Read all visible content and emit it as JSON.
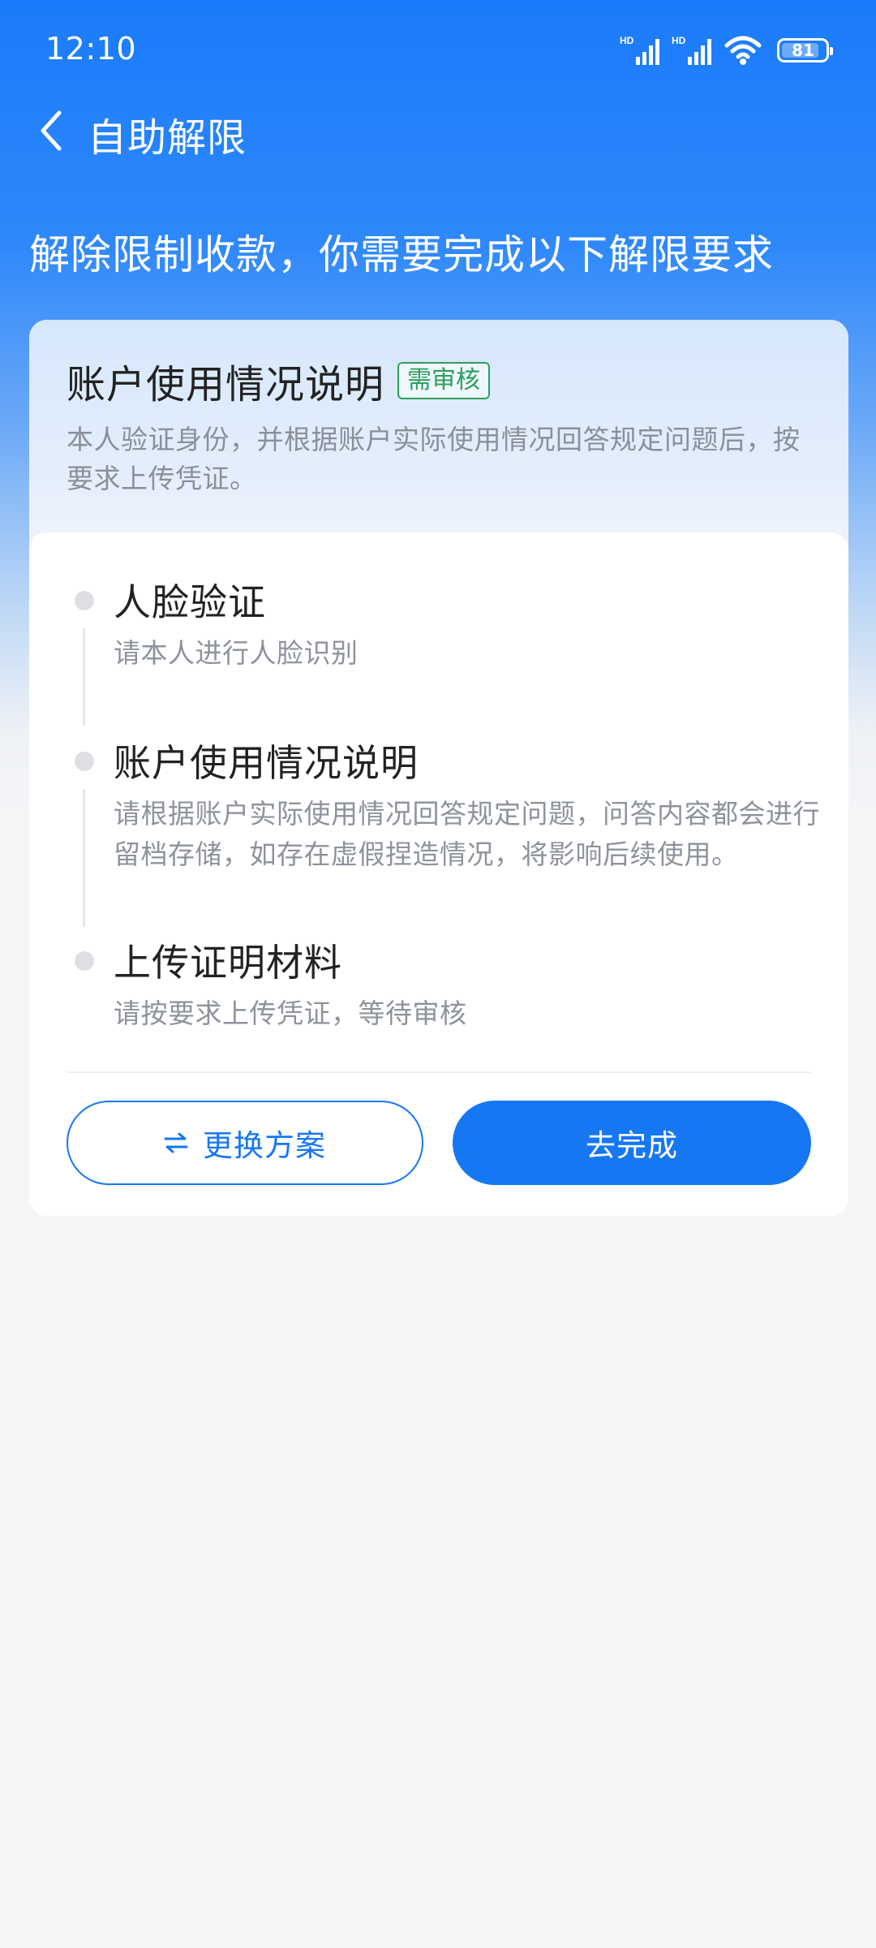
{
  "status_bar": {
    "time": "12:10",
    "battery_level": "81",
    "signal_1_label": "HD",
    "signal_2_label": "HD"
  },
  "nav": {
    "title": "自助解限",
    "back_icon": "chevron-left-icon"
  },
  "headline": "解除限制收款，你需要完成以下解限要求",
  "card": {
    "title": "账户使用情况说明",
    "badge": "需审核",
    "description": "本人验证身份，并根据账户实际使用情况回答规定问题后，按要求上传凭证。",
    "steps": [
      {
        "title": "人脸验证",
        "description": "请本人进行人脸识别"
      },
      {
        "title": "账户使用情况说明",
        "description": "请根据账户实际使用情况回答规定问题，问答内容都会进行留档存储，如存在虚假捏造情况，将影响后续使用。"
      },
      {
        "title": "上传证明材料",
        "description": "请按要求上传凭证，等待审核"
      }
    ],
    "switch_button_label": "更换方案",
    "switch_icon": "swap-arrows-icon",
    "complete_button_label": "去完成"
  },
  "colors": {
    "primary": "#1677f2",
    "badge_green": "#2aa05a",
    "header_blue": "#1a7bfa"
  }
}
